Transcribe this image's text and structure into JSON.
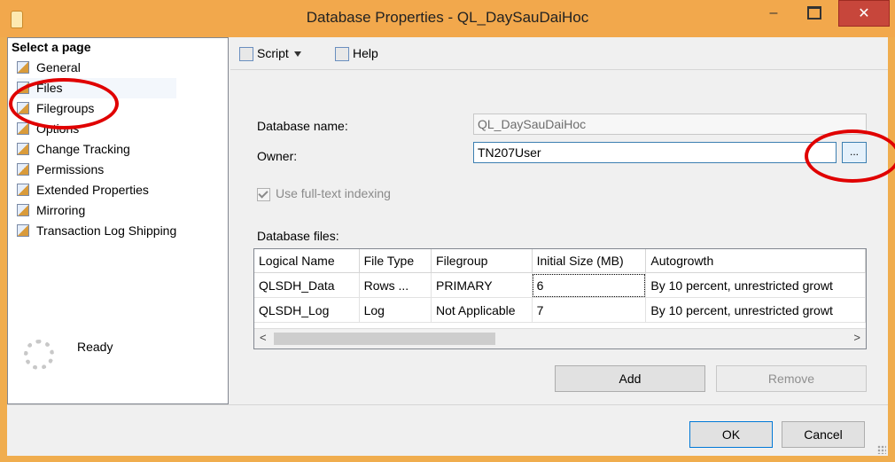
{
  "window": {
    "title": "Database Properties - QL_DaySauDaiHoc",
    "controls": {
      "minimize": "–",
      "close": "✕"
    }
  },
  "left_panel": {
    "header": "Select a page",
    "pages": [
      {
        "label": "General"
      },
      {
        "label": "Files"
      },
      {
        "label": "Filegroups"
      },
      {
        "label": "Options"
      },
      {
        "label": "Change Tracking"
      },
      {
        "label": "Permissions"
      },
      {
        "label": "Extended Properties"
      },
      {
        "label": "Mirroring"
      },
      {
        "label": "Transaction Log Shipping"
      }
    ],
    "status": "Ready"
  },
  "toolbar": {
    "script_label": "Script",
    "help_label": "Help"
  },
  "form": {
    "db_name_label": "Database name:",
    "db_name_value": "QL_DaySauDaiHoc",
    "owner_label": "Owner:",
    "owner_value": "TN207User",
    "browse_label": "...",
    "fulltext_label": "Use full-text indexing",
    "files_label": "Database files:"
  },
  "files_table": {
    "columns": [
      "Logical Name",
      "File Type",
      "Filegroup",
      "Initial Size (MB)",
      "Autogrowth"
    ],
    "rows": [
      [
        "QLSDH_Data",
        "Rows ...",
        "PRIMARY",
        "6",
        "By 10 percent, unrestricted growt"
      ],
      [
        "QLSDH_Log",
        "Log",
        "Not Applicable",
        "7",
        "By 10 percent, unrestricted growt"
      ]
    ],
    "scroll_left": "<",
    "scroll_right": ">"
  },
  "buttons": {
    "add": "Add",
    "remove": "Remove",
    "ok": "OK",
    "cancel": "Cancel"
  },
  "colors": {
    "title_bar": "#f2a84c",
    "close_button": "#c7463b",
    "annotation": "#e00000"
  }
}
